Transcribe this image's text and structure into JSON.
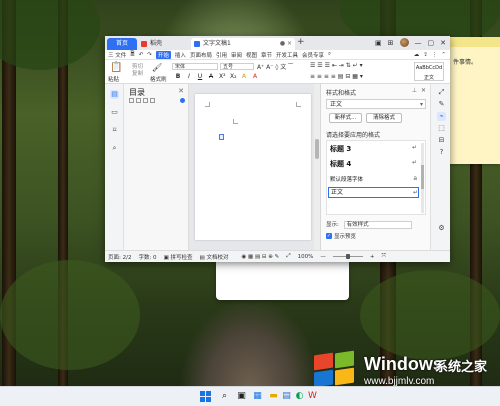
{
  "sticky_note": {
    "text": "件事情。"
  },
  "window": {
    "tabs": [
      {
        "label": "首页",
        "icon": "home"
      },
      {
        "label": "稻壳",
        "icon": "docer-icon"
      },
      {
        "label": "文字文稿1",
        "icon": "writer-doc-icon",
        "closable": true
      }
    ],
    "new_tab": "+",
    "title_controls": [
      "layout-icon",
      "avatar",
      "minimize-icon",
      "maximize-icon",
      "close-icon"
    ]
  },
  "menubar": {
    "file": "三 文件",
    "items": [
      "开始",
      "插入",
      "页面布局",
      "引用",
      "审阅",
      "视图",
      "章节",
      "开发工具",
      "会员专享"
    ],
    "active": "开始",
    "search_icon": "search-icon"
  },
  "ribbon": {
    "paste": "粘贴",
    "cut": "剪切",
    "copy": "复制",
    "format_painter": "格式刷",
    "font_name": "宋体",
    "font_size": "五号",
    "format_buttons": [
      "B",
      "I",
      "U",
      "A",
      "X²",
      "X₂",
      "A",
      "A"
    ],
    "style_sample": "AaBbCcDd",
    "style_label": "正文"
  },
  "toc": {
    "title": "目录",
    "close": "✕"
  },
  "style_pane": {
    "title": "样式和格式",
    "current_style": "正文",
    "new_style_button": "新样式...",
    "clear_format_button": "清除格式",
    "apply_label": "请选择要应用的格式",
    "styles": [
      {
        "name": "标题 3",
        "bold": true,
        "size": 7
      },
      {
        "name": "标题 4",
        "bold": true,
        "size": 7
      },
      {
        "name": "默认段落字体",
        "bold": false,
        "size": 5.5
      },
      {
        "name": "正文",
        "bold": false,
        "size": 6,
        "selected": true
      }
    ],
    "show_label": "显示:",
    "show_value": "有效样式",
    "preview_label": "显示预览",
    "preview_checked": true
  },
  "statusbar": {
    "page": "页面: 2/2",
    "words": "字数: 0",
    "spellcheck": "拼写检查",
    "proofread": "文档校对",
    "zoom": "100%",
    "zoom_level": 0.5
  },
  "watermark": {
    "brand": "Windows",
    "suffix": "系统之家",
    "url": "www.bjjmlv.com"
  },
  "taskbar": {
    "icons": [
      "start-icon",
      "search-icon",
      "task-view-icon",
      "widgets-icon",
      "explorer-icon",
      "store-icon",
      "edge-icon",
      "wps-icon"
    ]
  }
}
